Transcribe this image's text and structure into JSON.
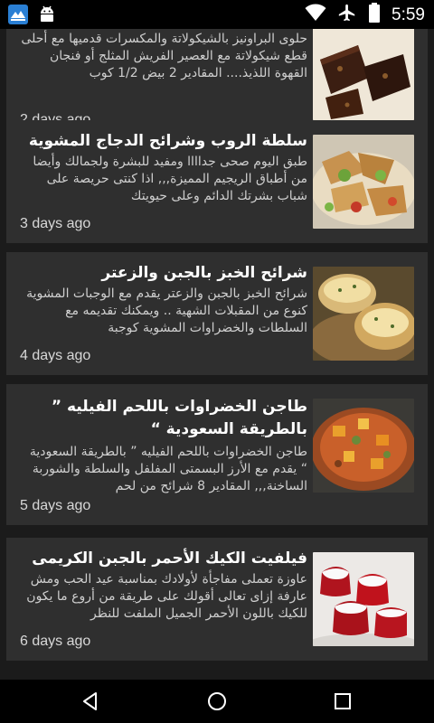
{
  "status_bar": {
    "time": "5:59",
    "icons": [
      "app-icon",
      "android-icon",
      "wifi-icon",
      "airplane-icon",
      "battery-icon"
    ]
  },
  "cards": [
    {
      "title": "",
      "desc": "حلوى البراونيز بالشيكولاتة والمكسرات قدميها مع أحلى قطع شيكولاتة مع العصير الفريش المثلج أو فنجان القهوة اللذيذ.... المقادير 2 بيض 1/2 كوب",
      "date": "2 days ago",
      "image": "brownies"
    },
    {
      "title": "سلطة الروب وشرائح الدجاج المشوية",
      "desc": "طبق اليوم صحى جداااا ومفيد للبشرة ولجمالك وأيضا من أطباق الريجيم المميزة,,, اذا كنتى حريصة على شباب بشرتك الدائم وعلى حيويتك",
      "date": "3 days ago",
      "image": "chicken-salad"
    },
    {
      "title": "شرائح الخبز بالجبن والزعتر",
      "desc": "شرائح الخبز بالجبن والزعتر يقدم مع الوجبات المشوية كنوع من المقبلات الشهية .. ويمكنك تقديمه مع السلطات والخضراوات المشوية كوجبة",
      "date": "4 days ago",
      "image": "cheese-bread"
    },
    {
      "title": "طاجن الخضراوات باللحم الفيليه ” بالطريقة السعودية “",
      "desc": "طاجن الخضراوات باللحم الفيليه ” بالطريقة السعودية “ يقدم مع الأرز البسمتى المفلفل والسلطة والشوربة الساخنة,,, المقادير 8 شرائح من لحم",
      "date": "5 days ago",
      "image": "vegetable-tagine"
    },
    {
      "title": "فيلفيت الكيك الأحمر بالجبن الكريمى",
      "desc": "عاوزة تعملى مفاجأة لأولادك بمناسبة عيد الحب ومش عارفة إزاى تعالى أقولك على طريقة من أروع ما يكون للكيك باللون الأحمر الجميل الملفت للنظر",
      "date": "6 days ago",
      "image": "red-velvet-cake"
    }
  ],
  "nav": {
    "back": "back-icon",
    "home": "home-icon",
    "recents": "recents-icon"
  }
}
